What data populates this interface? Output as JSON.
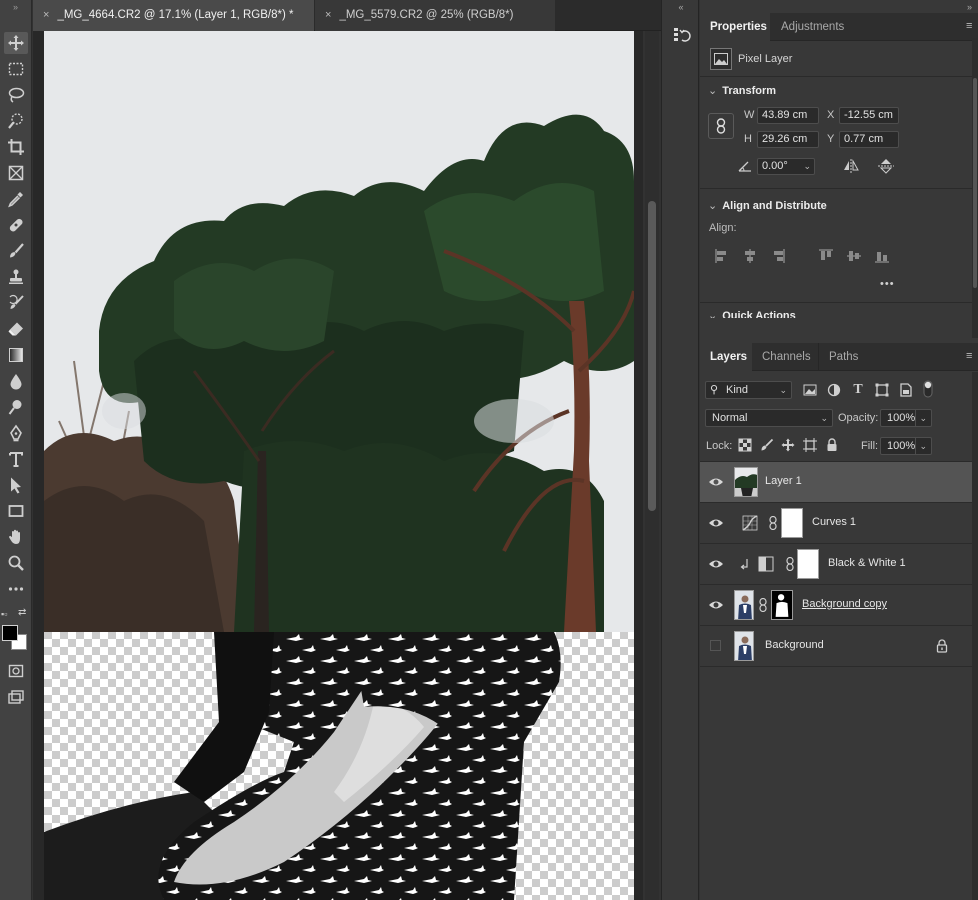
{
  "document_tabs": [
    {
      "label": "_MG_4664.CR2 @ 17.1% (Layer 1, RGB/8*) *",
      "active": true
    },
    {
      "label": "_MG_5579.CR2 @ 25% (RGB/8*)",
      "active": false
    }
  ],
  "tab_close_glyph": "×",
  "toolbar": {
    "tools": [
      "move-icon",
      "marquee-icon",
      "lasso-icon",
      "quick-select-icon",
      "crop-icon",
      "frame-icon",
      "eyedropper-icon",
      "healing-icon",
      "brush-icon",
      "stamp-icon",
      "history-brush-icon",
      "eraser-icon",
      "gradient-icon",
      "blur-icon",
      "dodge-icon",
      "pen-icon",
      "type-icon",
      "path-select-icon",
      "rectangle-icon",
      "hand-icon",
      "zoom-icon",
      "more-tools-icon"
    ],
    "foreground_color": "#000000",
    "background_color": "#ffffff"
  },
  "properties": {
    "tabs": [
      {
        "label": "Properties",
        "active": true
      },
      {
        "label": "Adjustments",
        "active": false
      }
    ],
    "layer_kind": "Pixel Layer",
    "transform": {
      "heading": "Transform",
      "w_label": "W",
      "w_value": "43.89 cm",
      "h_label": "H",
      "h_value": "29.26 cm",
      "x_label": "X",
      "x_value": "-12.55 cm",
      "y_label": "Y",
      "y_value": "0.77 cm",
      "angle_value": "0.00°"
    },
    "align": {
      "heading": "Align and Distribute",
      "label": "Align:",
      "more": "•••"
    },
    "quick_actions": {
      "heading": "Quick Actions"
    }
  },
  "layers_panel": {
    "tabs": [
      {
        "label": "Layers",
        "active": true
      },
      {
        "label": "Channels",
        "active": false
      },
      {
        "label": "Paths",
        "active": false
      }
    ],
    "filter_kind": "Kind",
    "blend_mode": "Normal",
    "opacity_label": "Opacity:",
    "opacity_value": "100%",
    "lock_label": "Lock:",
    "fill_label": "Fill:",
    "fill_value": "100%",
    "layers": [
      {
        "name": "Layer 1",
        "visible": true,
        "selected": true
      },
      {
        "name": "Curves 1",
        "visible": true,
        "selected": false
      },
      {
        "name": "Black & White 1",
        "visible": true,
        "selected": false
      },
      {
        "name": "Background copy",
        "visible": true,
        "selected": false
      },
      {
        "name": "Background",
        "visible": false,
        "selected": false
      }
    ]
  },
  "colors": {
    "ui_bg": "#383838",
    "panel_tab_bg": "#2e2e2e",
    "selected_layer": "#545454"
  }
}
